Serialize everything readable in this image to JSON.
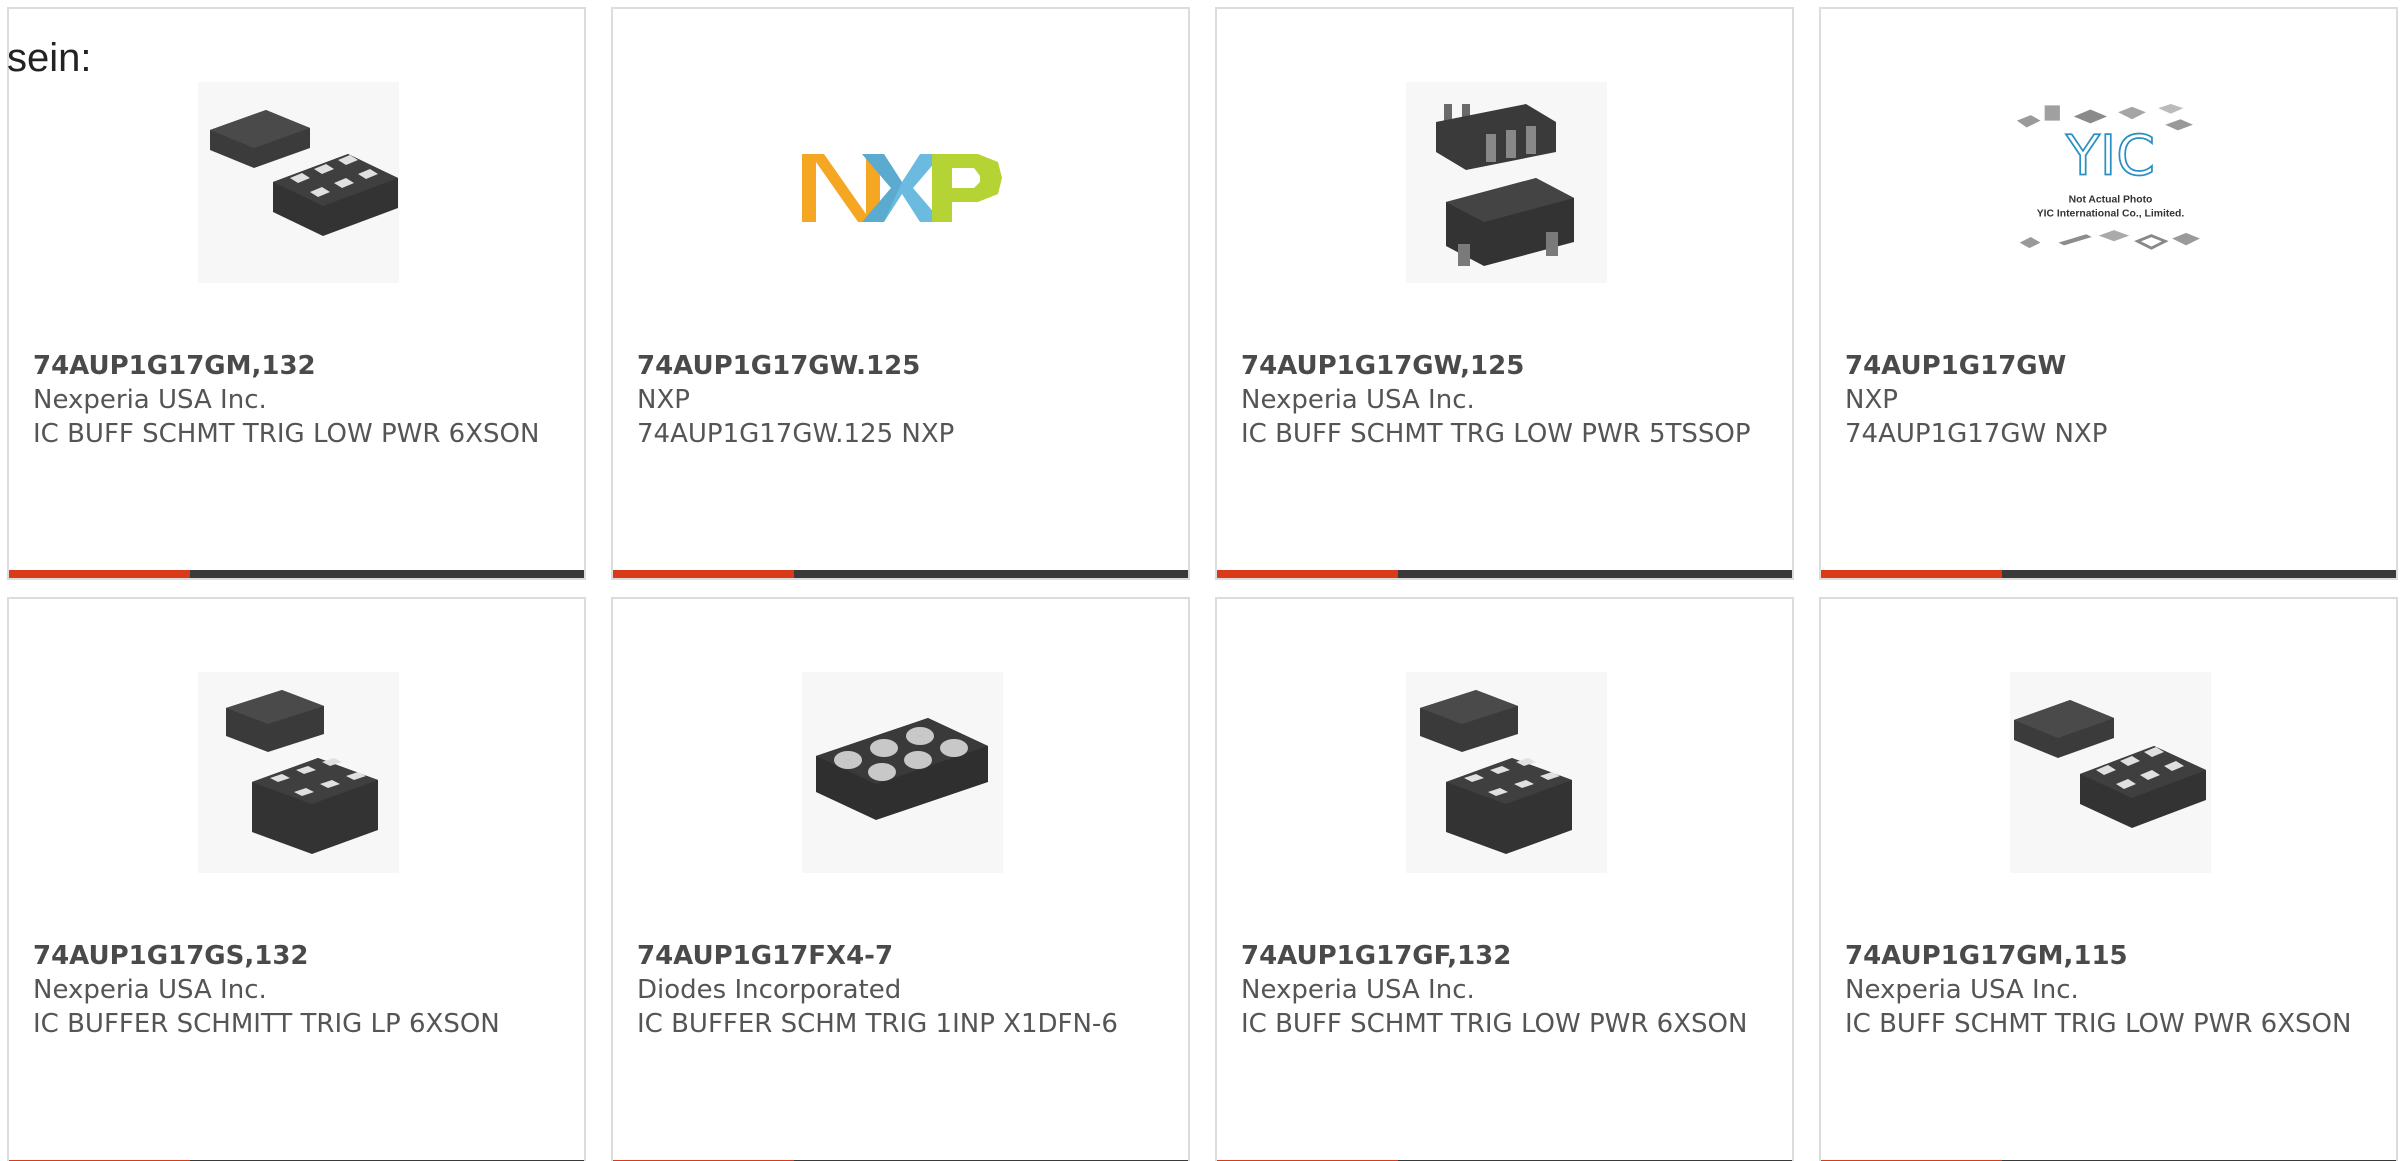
{
  "lead_text": "sein:",
  "colors": {
    "accent": "#d93a17",
    "bar": "#3a3a3a",
    "border": "#dcdcdc",
    "text": "#555555"
  },
  "products": [
    {
      "part_number": "74AUP1G17GM,132",
      "manufacturer": "Nexperia USA Inc.",
      "description": "IC BUFF SCHMT TRIG LOW PWR 6XSON",
      "image": "xson-package-icon"
    },
    {
      "part_number": "74AUP1G17GW.125",
      "manufacturer": "NXP",
      "description": "74AUP1G17GW.125 NXP",
      "image": "nxp-logo",
      "logo_text": "NXP"
    },
    {
      "part_number": "74AUP1G17GW,125",
      "manufacturer": "Nexperia USA Inc.",
      "description": "IC BUFF SCHMT TRG LOW PWR 5TSSOP",
      "image": "tssop-package-icon"
    },
    {
      "part_number": "74AUP1G17GW",
      "manufacturer": "NXP",
      "description": "74AUP1G17GW NXP",
      "image": "yic-placeholder-image",
      "logo_text": "YIC",
      "photo_caption_1": "Not Actual Photo",
      "photo_caption_2": "YIC International Co., Limited."
    },
    {
      "part_number": "74AUP1G17GS,132",
      "manufacturer": "Nexperia USA Inc.",
      "description": "IC BUFFER SCHMITT TRIG LP 6XSON",
      "image": "xson-package-icon"
    },
    {
      "part_number": "74AUP1G17FX4-7",
      "manufacturer": "Diodes Incorporated",
      "description": "IC BUFFER SCHM TRIG 1INP X1DFN-6",
      "image": "x1dfn-package-icon"
    },
    {
      "part_number": "74AUP1G17GF,132",
      "manufacturer": "Nexperia USA Inc.",
      "description": "IC BUFF SCHMT TRIG LOW PWR 6XSON",
      "image": "xson-package-icon"
    },
    {
      "part_number": "74AUP1G17GM,115",
      "manufacturer": "Nexperia USA Inc.",
      "description": "IC BUFF SCHMT TRIG LOW PWR 6XSON",
      "image": "xson-package-icon"
    }
  ]
}
